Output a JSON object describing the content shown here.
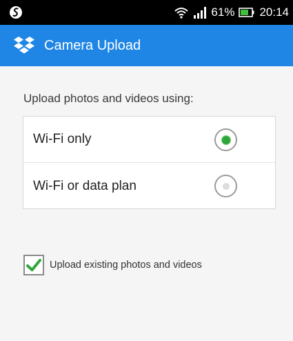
{
  "status_bar": {
    "battery_percent": "61%",
    "time": "20:14",
    "icons": [
      "shazam-like-app-icon",
      "wifi-icon",
      "signal-icon",
      "battery-icon"
    ]
  },
  "app_bar": {
    "title": "Camera Upload",
    "logo_icon": "dropbox-icon",
    "color": "#1f86e6"
  },
  "main": {
    "section_label": "Upload photos and videos using:",
    "options": [
      {
        "label": "Wi-Fi only",
        "selected": true
      },
      {
        "label": "Wi-Fi or data plan",
        "selected": false
      }
    ],
    "checkbox": {
      "label": "Upload existing photos and videos",
      "checked": true
    }
  },
  "colors": {
    "accent_green": "#2fa63a",
    "app_bar_blue": "#1f86e6"
  }
}
